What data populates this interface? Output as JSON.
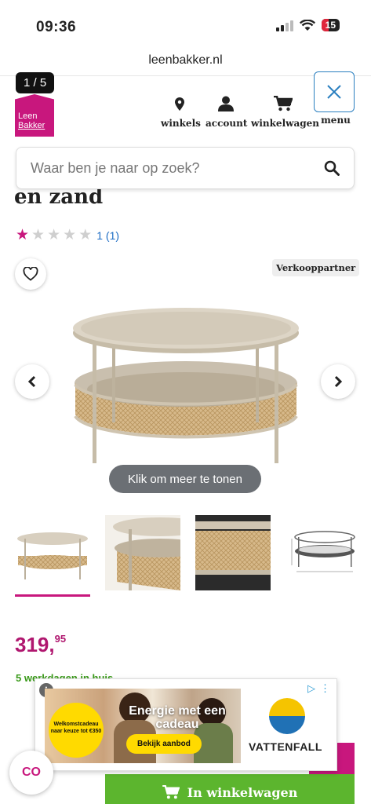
{
  "status_bar": {
    "time": "09:36",
    "battery": "15"
  },
  "browser": {
    "url": "leenbakker.nl"
  },
  "gallery_counter": "1 / 5",
  "brand": {
    "line1": "Leen",
    "line2": "Bakker",
    "color": "#c8177d"
  },
  "nav": {
    "items": [
      {
        "label": "winkels",
        "icon": "location-pin-icon"
      },
      {
        "label": "account",
        "icon": "user-icon"
      },
      {
        "label": "winkelwagen",
        "icon": "cart-icon"
      },
      {
        "label": "menu",
        "icon": "close-icon"
      }
    ]
  },
  "search": {
    "placeholder": "Waar ben je naar op zoek?"
  },
  "product": {
    "title_partial": "en zand",
    "rating": {
      "stars_filled": 1,
      "stars_total": 5,
      "count_text": "1 (1)"
    },
    "seller_badge": "Verkooppartner",
    "more_button": "Klik om meer te tonen",
    "price_main": "319,",
    "price_cents": "95",
    "delivery": "5 werkdagen in huis",
    "add_to_cart": "In winkelwagen",
    "thumbnails_count": 4
  },
  "chat_label": "CO",
  "ad": {
    "info": "i",
    "badge_text": "Welkomstcadeau naar keuze tot €350",
    "headline": "Energie met een cadeau",
    "cta": "Bekijk aanbod",
    "brand": "VATTENFALL"
  },
  "colors": {
    "accent": "#c8177d",
    "price": "#b0176f",
    "cart_green": "#5cb52e",
    "link_blue": "#1a6bc4"
  }
}
